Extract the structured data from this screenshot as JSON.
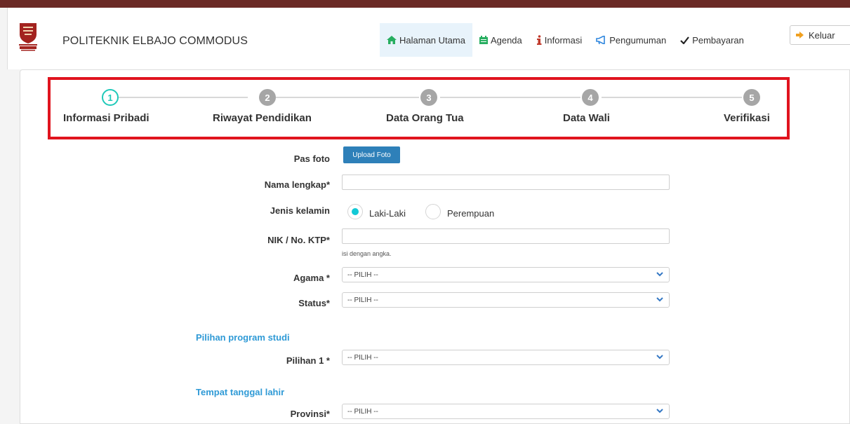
{
  "header": {
    "brand": "POLITEKNIK ELBAJO COMMODUS",
    "nav": [
      {
        "label": "Halaman Utama",
        "icon": "home-icon",
        "color": "#27ae60"
      },
      {
        "label": "Agenda",
        "icon": "calendar-icon",
        "color": "#27ae60"
      },
      {
        "label": "Informasi",
        "icon": "info-icon",
        "color": "#c0392b"
      },
      {
        "label": "Pengumuman",
        "icon": "megaphone-icon",
        "color": "#2e86de"
      },
      {
        "label": "Pembayaran",
        "icon": "check-icon",
        "color": "#222222"
      }
    ],
    "logout": "Keluar"
  },
  "stepper": {
    "accent": "#1fc9b9",
    "steps": [
      {
        "number": "1",
        "label": "Informasi Pribadi"
      },
      {
        "number": "2",
        "label": "Riwayat Pendidikan"
      },
      {
        "number": "3",
        "label": "Data Orang Tua"
      },
      {
        "number": "4",
        "label": "Data Wali"
      },
      {
        "number": "5",
        "label": "Verifikasi"
      }
    ]
  },
  "form": {
    "photo_label": "Pas foto",
    "upload_button": "Upload Foto",
    "name_label": "Nama lengkap*",
    "gender_label": "Jenis kelamin",
    "gender_male": "Laki-Laki",
    "gender_female": "Perempuan",
    "nik_label": "NIK / No. KTP*",
    "nik_hint": "isi dengan angka.",
    "religion_label": "Agama *",
    "religion_value": "-- PILIH --",
    "status_label": "Status*",
    "status_value": "-- PILIH --",
    "study_section": "Pilihan program studi",
    "choice1_label": "Pilihan 1 *",
    "choice1_value": "-- PILIH --",
    "birth_section": "Tempat tanggal lahir",
    "province_label": "Provinsi*",
    "province_value": "-- PILIH --"
  }
}
